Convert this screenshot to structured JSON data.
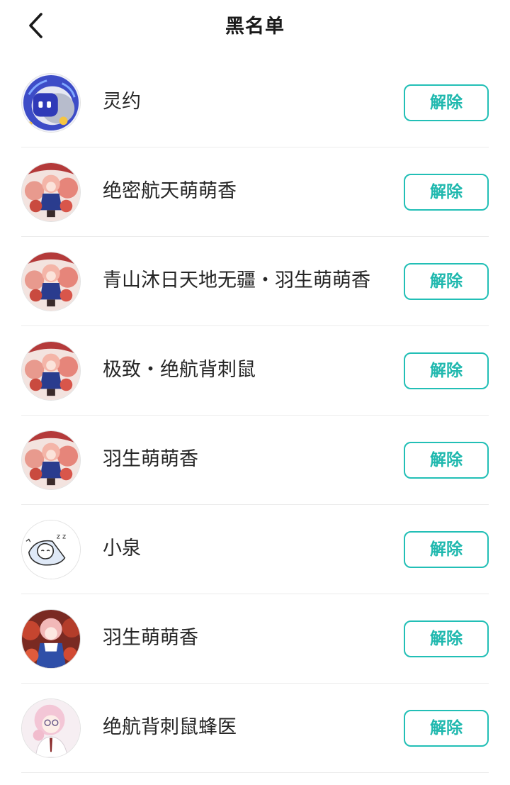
{
  "header": {
    "title": "黑名单",
    "back_icon": "chevron-left-icon"
  },
  "colors": {
    "accent": "#22bfb6",
    "divider": "#ececec",
    "text": "#262626"
  },
  "blacklist": [
    {
      "name": "灵约",
      "avatar": "robot-avatar",
      "action": "解除"
    },
    {
      "name": "绝密航天萌萌香",
      "avatar": "anime-girl-avatar",
      "action": "解除"
    },
    {
      "name": "青山沐日天地无疆・羽生萌萌香",
      "avatar": "anime-girl-avatar",
      "action": "解除"
    },
    {
      "name": "极致・绝航背刺鼠",
      "avatar": "anime-girl-avatar",
      "action": "解除"
    },
    {
      "name": "羽生萌萌香",
      "avatar": "anime-girl-avatar",
      "action": "解除"
    },
    {
      "name": "小泉",
      "avatar": "sleeping-cat-avatar",
      "action": "解除"
    },
    {
      "name": "羽生萌萌香",
      "avatar": "anime-girl-dark-avatar",
      "action": "解除"
    },
    {
      "name": "绝航背刺鼠蜂医",
      "avatar": "pink-hair-girl-avatar",
      "action": "解除"
    }
  ]
}
